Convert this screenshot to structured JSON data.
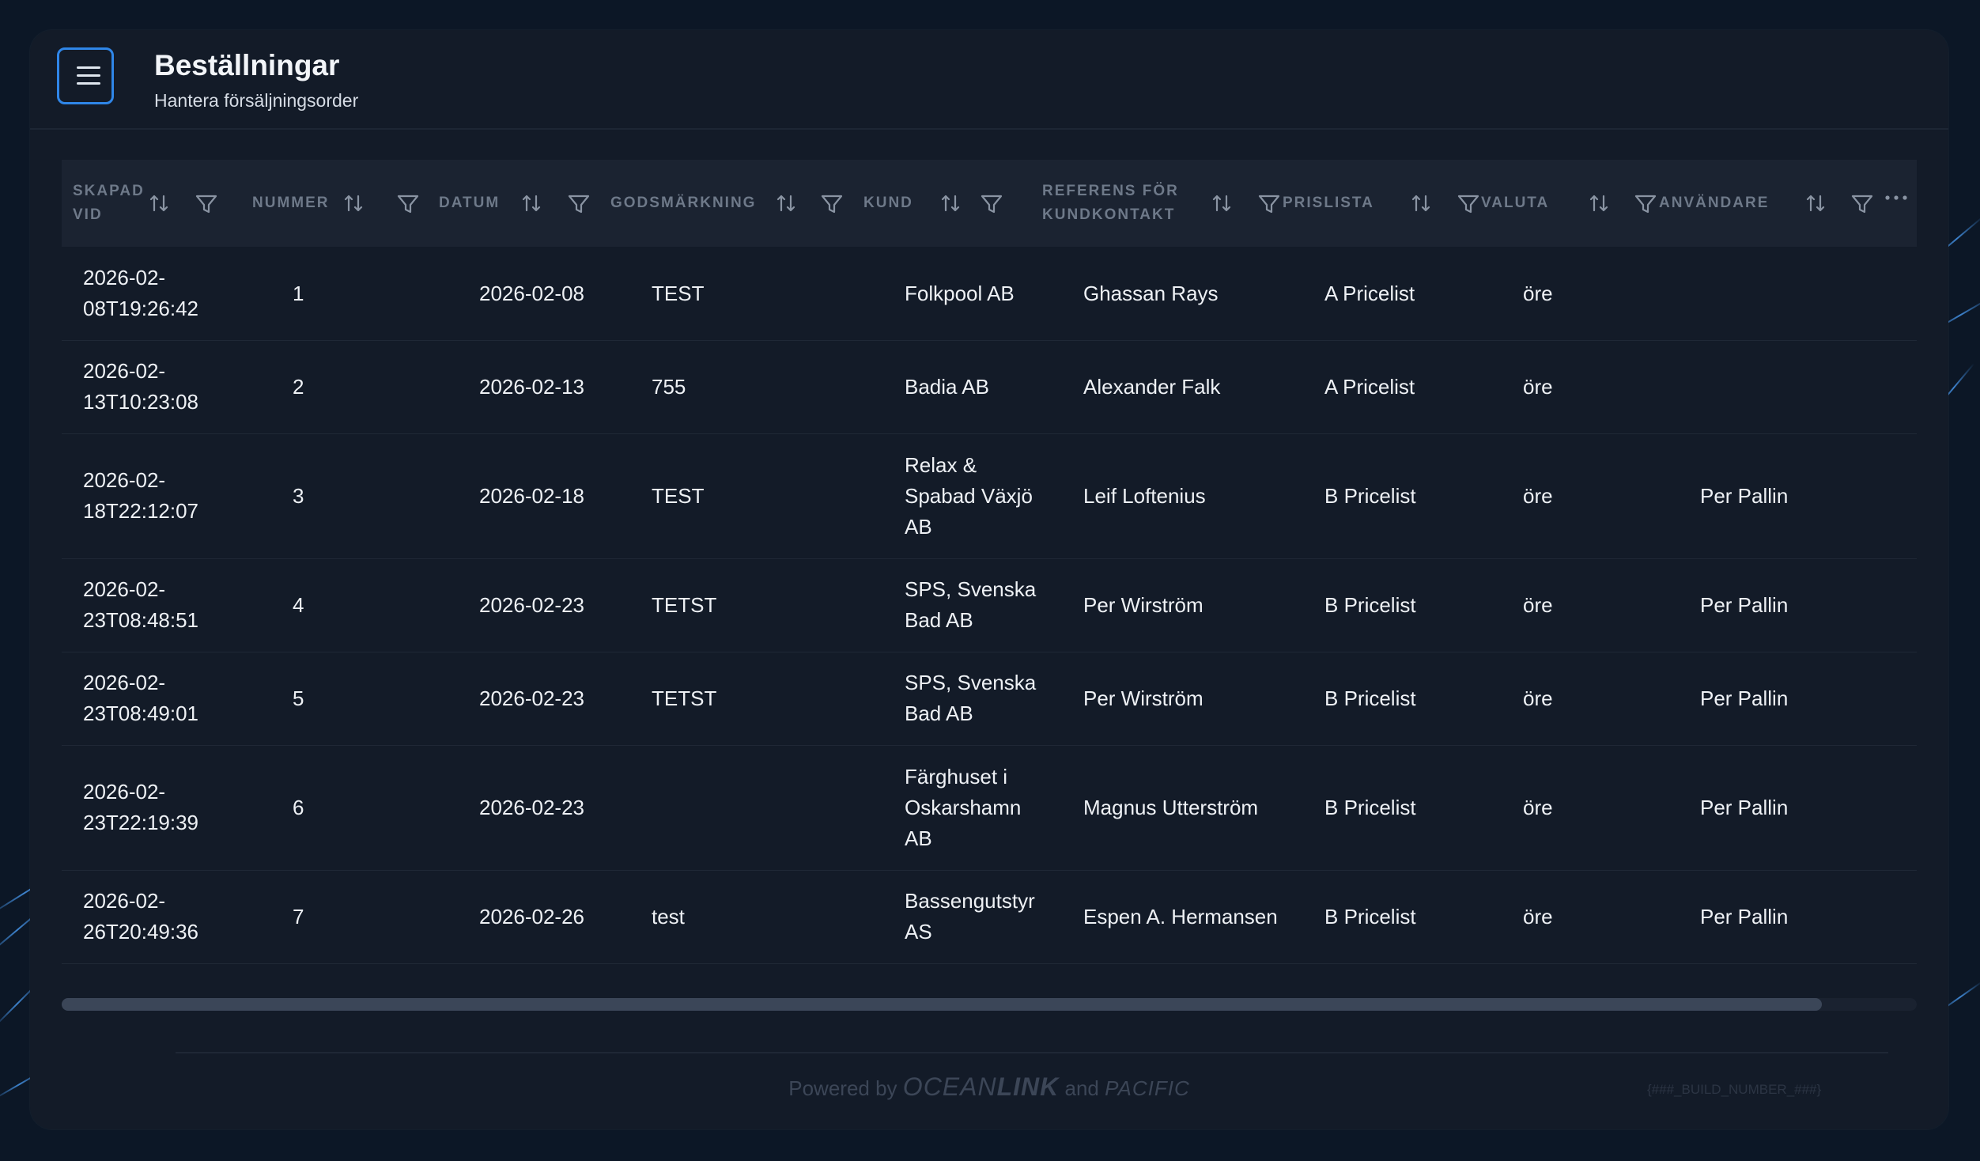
{
  "header": {
    "title": "Beställningar",
    "subtitle": "Hantera försäljningsorder",
    "menu_icon": "hamburger-menu-icon"
  },
  "columns": [
    {
      "key": "skapad_vid",
      "lines": [
        "SKAPAD",
        "VID"
      ]
    },
    {
      "key": "nummer",
      "lines": [
        "NUMMER"
      ]
    },
    {
      "key": "datum",
      "lines": [
        "DATUM"
      ]
    },
    {
      "key": "godsmarkning",
      "lines": [
        "GODSMÄRKNING"
      ]
    },
    {
      "key": "kund",
      "lines": [
        "KUND"
      ]
    },
    {
      "key": "referens",
      "lines": [
        "REFERENS FÖR",
        "KUNDKONTAKT"
      ]
    },
    {
      "key": "prislista",
      "lines": [
        "PRISLISTA"
      ]
    },
    {
      "key": "valuta",
      "lines": [
        "VALUTA"
      ]
    },
    {
      "key": "anvandare",
      "lines": [
        "ANVÄNDARE"
      ]
    }
  ],
  "column_icons": {
    "sort": "sort-arrows-icon",
    "filter": "filter-funnel-icon",
    "more": "more-options-icon"
  },
  "rows": [
    {
      "skapad_vid": [
        "2026-02-",
        "08T19:26:42"
      ],
      "nummer": "1",
      "datum": "2026-02-08",
      "godsmarkning": "TEST",
      "kund": [
        "Folkpool AB"
      ],
      "referens": "Ghassan Rays",
      "prislista": "A Pricelist",
      "valuta": "öre",
      "anvandare": ""
    },
    {
      "skapad_vid": [
        "2026-02-",
        "13T10:23:08"
      ],
      "nummer": "2",
      "datum": "2026-02-13",
      "godsmarkning": "755",
      "kund": [
        "Badia AB"
      ],
      "referens": "Alexander Falk",
      "prislista": "A Pricelist",
      "valuta": "öre",
      "anvandare": ""
    },
    {
      "skapad_vid": [
        "2026-02-",
        "18T22:12:07"
      ],
      "nummer": "3",
      "datum": "2026-02-18",
      "godsmarkning": "TEST",
      "kund": [
        "Relax &",
        "Spabad Växjö",
        "AB"
      ],
      "referens": "Leif Loftenius",
      "prislista": "B Pricelist",
      "valuta": "öre",
      "anvandare": "Per Pallin"
    },
    {
      "skapad_vid": [
        "2026-02-",
        "23T08:48:51"
      ],
      "nummer": "4",
      "datum": "2026-02-23",
      "godsmarkning": "TETST",
      "kund": [
        "SPS, Svenska",
        "Bad AB"
      ],
      "referens": "Per Wirström",
      "prislista": "B Pricelist",
      "valuta": "öre",
      "anvandare": "Per Pallin"
    },
    {
      "skapad_vid": [
        "2026-02-",
        "23T08:49:01"
      ],
      "nummer": "5",
      "datum": "2026-02-23",
      "godsmarkning": "TETST",
      "kund": [
        "SPS, Svenska",
        "Bad AB"
      ],
      "referens": "Per Wirström",
      "prislista": "B Pricelist",
      "valuta": "öre",
      "anvandare": "Per Pallin"
    },
    {
      "skapad_vid": [
        "2026-02-",
        "23T22:19:39"
      ],
      "nummer": "6",
      "datum": "2026-02-23",
      "godsmarkning": "",
      "kund": [
        "Färghuset i",
        "Oskarshamn",
        "AB"
      ],
      "referens": "Magnus Utterström",
      "prislista": "B Pricelist",
      "valuta": "öre",
      "anvandare": "Per Pallin"
    },
    {
      "skapad_vid": [
        "2026-02-",
        "26T20:49:36"
      ],
      "nummer": "7",
      "datum": "2026-02-26",
      "godsmarkning": "test",
      "kund": [
        "Bassengutstyr",
        "AS"
      ],
      "referens": "Espen A. Hermansen",
      "prislista": "B Pricelist",
      "valuta": "öre",
      "anvandare": "Per Pallin"
    }
  ],
  "footer": {
    "powered_by": "Powered by",
    "brand_light": "OCEAN",
    "brand_bold": "LINK",
    "and": "and",
    "partner": "PACIFIC",
    "build": "{###_BUILD_NUMBER_###}"
  },
  "colors": {
    "background": "#0c1726",
    "card": "#131b28",
    "header_row": "#1b2331",
    "accent": "#2f86e8",
    "header_text": "#6e7989",
    "cell_text": "#eef1f5"
  }
}
